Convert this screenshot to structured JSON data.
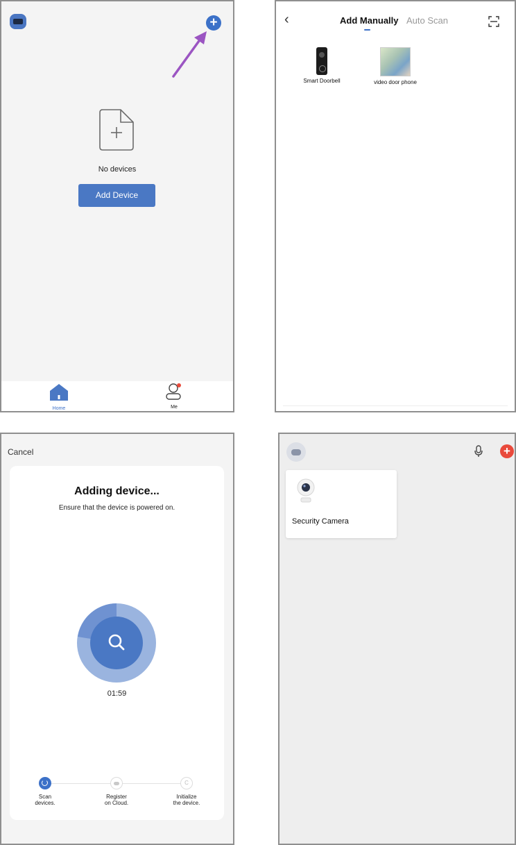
{
  "panel1": {
    "empty_text": "No devices",
    "add_device_label": "Add Device",
    "tabs": [
      {
        "label": "Home"
      },
      {
        "label": "Me"
      }
    ],
    "colors": {
      "accent": "#3c71c8",
      "arrow": "#9b55c2"
    }
  },
  "panel2": {
    "tabs": {
      "manual": "Add Manually",
      "auto": "Auto Scan"
    },
    "devices": [
      {
        "label": "Smart Doorbell"
      },
      {
        "label": "video door phone"
      }
    ]
  },
  "panel3": {
    "cancel_label": "Cancel",
    "title": "Adding device...",
    "subtitle": "Ensure that the device is powered on.",
    "timer": "01:59",
    "steps": [
      {
        "line1": "Scan",
        "line2": "devices."
      },
      {
        "line1": "Register",
        "line2": "on Cloud."
      },
      {
        "line1": "Initialize",
        "line2": "the device."
      }
    ]
  },
  "panel4": {
    "device_label": "Security Camera",
    "colors": {
      "plus": "#e94a3c"
    }
  }
}
